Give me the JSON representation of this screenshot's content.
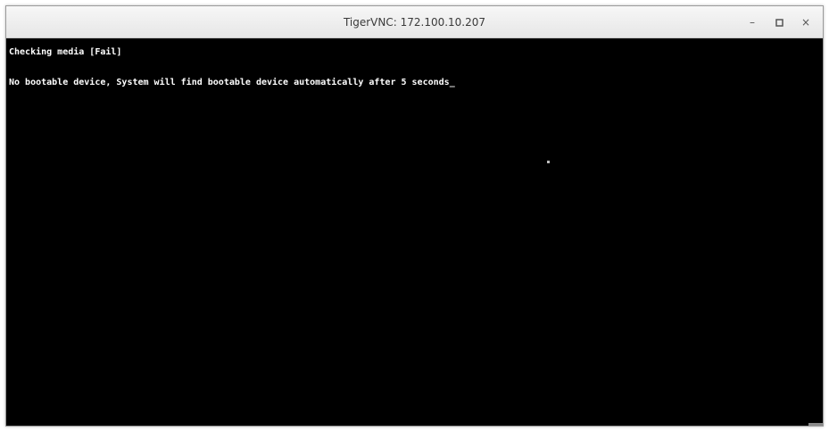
{
  "window": {
    "title": "TigerVNC: 172.100.10.207",
    "controls": {
      "minimize_label": "–",
      "maximize_icon": "maximize-icon",
      "close_label": "×"
    }
  },
  "console": {
    "lines": [
      "Checking media [Fail]",
      "No bootable device, System will find bootable device automatically after 5 seconds"
    ],
    "cursor": "_"
  },
  "colors": {
    "console_bg": "#000000",
    "console_text": "#ffffff",
    "titlebar_bg": "#eeeeee",
    "title_text": "#3a3a3a"
  }
}
